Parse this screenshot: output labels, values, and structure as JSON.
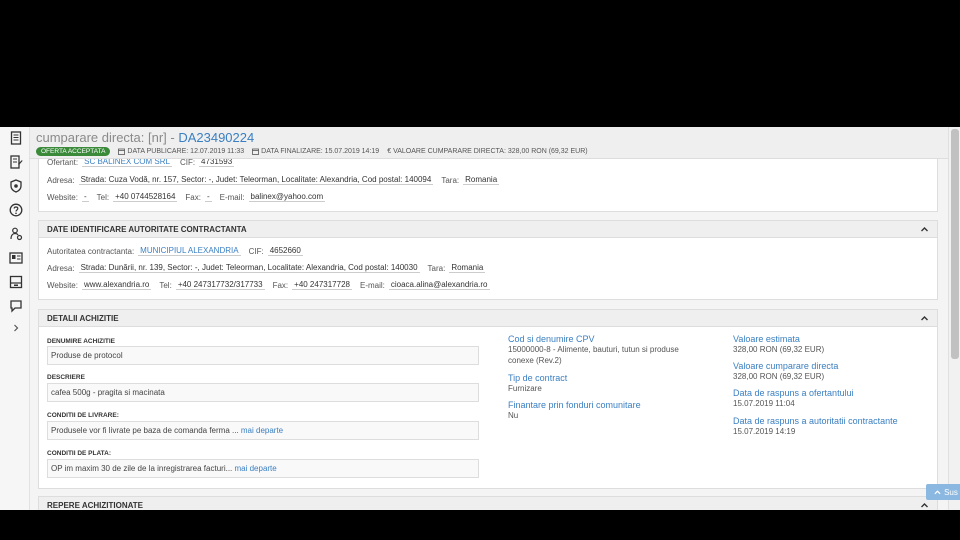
{
  "header": {
    "title_prefix": "cumparare directa: [nr] - ",
    "title_link": "DA23490224",
    "badge": "OFERTA ACCEPTATA",
    "data_publicare": "DATA PUBLICARE: 12.07.2019 11:33",
    "data_finalizare": "DATA FINALIZARE: 15.07.2019 14:19",
    "valoare": "VALOARE CUMPARARE DIRECTA: 328,00 RON (69,32 EUR)",
    "valoare_symbol": "€"
  },
  "ofertant": {
    "label": "Ofertant:",
    "name": "SC BALINEX COM SRL",
    "cif_label": "CIF:",
    "cif": "4731593",
    "adresa_label": "Adresa:",
    "adresa": "Strada: Cuza Vodă, nr. 157, Sector: -, Judet: Teleorman, Localitate: Alexandria, Cod postal: 140094",
    "tara_label": "Tara:",
    "tara": "Romania",
    "website_label": "Website:",
    "website": "-",
    "tel_label": "Tel:",
    "tel": "+40 0744528164",
    "fax_label": "Fax:",
    "fax": "-",
    "email_label": "E-mail:",
    "email": "balinex@yahoo.com"
  },
  "autoritate": {
    "title": "DATE IDENTIFICARE AUTORITATE CONTRACTANTA",
    "label": "Autoritatea contractanta:",
    "name": "MUNICIPIUL ALEXANDRIA",
    "cif_label": "CIF:",
    "cif": "4652660",
    "adresa_label": "Adresa:",
    "adresa": "Strada: Dunării, nr. 139, Sector: -, Judet: Teleorman, Localitate: Alexandria, Cod postal: 140030",
    "tara_label": "Tara:",
    "tara": "Romania",
    "website_label": "Website:",
    "website": "www.alexandria.ro",
    "tel_label": "Tel:",
    "tel": "+40 247317732/317733",
    "fax_label": "Fax:",
    "fax": "+40 247317728",
    "email_label": "E-mail:",
    "email": "cioaca.alina@alexandria.ro"
  },
  "detalii": {
    "title": "DETALII ACHIZITIE",
    "denumire_label": "DENUMIRE ACHIZITIE",
    "denumire": "Produse de protocol",
    "descriere_label": "DESCRIERE",
    "descriere": "cafea 500g - pragita si macinata",
    "livrare_label": "CONDITII DE LIVRARE:",
    "livrare": "Produsele vor fi livrate pe baza de comanda ferma ... ",
    "plata_label": "CONDITII DE PLATA:",
    "plata": "OP im maxim 30 de zile de la inregistrarea facturi... ",
    "more": "mai departe",
    "cpv_label": "Cod si denumire CPV",
    "cpv_line1": "15000000-8 - Alimente, bauturi, tutun si produse",
    "cpv_line2": "conexe (Rev.2)",
    "tip_label": "Tip de contract",
    "tip": "Furnizare",
    "fonduri_label": "Finantare prin fonduri comunitare",
    "fonduri": "Nu",
    "val_est_label": "Valoare estimata",
    "val_est": "328,00  RON (69,32  EUR)",
    "val_cd_label": "Valoare cumparare directa",
    "val_cd": "328,00  RON (69,32  EUR)",
    "rasp_of_label": "Data de raspuns a ofertantului",
    "rasp_of": "15.07.2019 11:04",
    "rasp_ac_label": "Data de raspuns a autoritatii contractante",
    "rasp_ac": "15.07.2019 14:19"
  },
  "repere": {
    "title": "REPERE ACHIZITIONATE"
  },
  "sus_button": "Sus"
}
